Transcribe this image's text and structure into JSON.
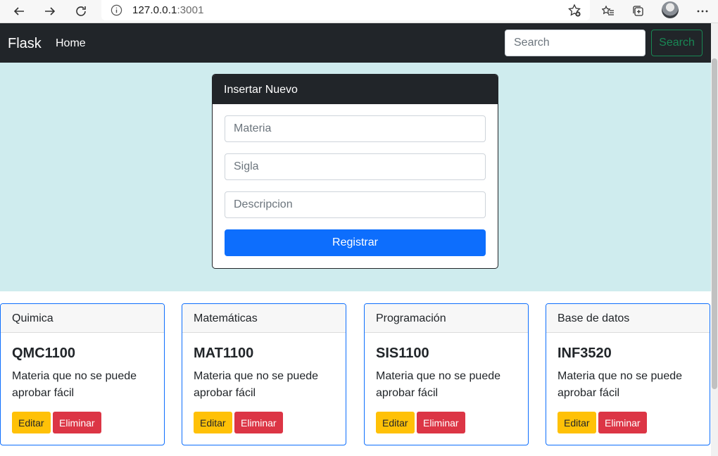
{
  "browser": {
    "url_host": "127.0.0.1",
    "url_port": ":3001",
    "icons": [
      "back-icon",
      "forward-icon",
      "refresh-icon",
      "info-icon",
      "add-favorite-icon",
      "favorites-icon",
      "collections-icon",
      "profile-avatar",
      "more-icon"
    ]
  },
  "navbar": {
    "brand": "Flask",
    "home": "Home",
    "search_placeholder": "Search",
    "search_button": "Search"
  },
  "form": {
    "title": "Insertar Nuevo",
    "materia_placeholder": "Materia",
    "sigla_placeholder": "Sigla",
    "descripcion_placeholder": "Descripcion",
    "submit": "Registrar"
  },
  "courses": [
    {
      "name": "Quimica",
      "code": "QMC1100",
      "description": "Materia que no se puede aprobar fácil"
    },
    {
      "name": "Matemáticas",
      "code": "MAT1100",
      "description": "Materia que no se puede aprobar fácil"
    },
    {
      "name": "Programación",
      "code": "SIS1100",
      "description": "Materia que no se puede aprobar fácil"
    },
    {
      "name": "Base de datos",
      "code": "INF3520",
      "description": "Materia que no se puede aprobar fácil"
    }
  ],
  "card_actions": {
    "edit": "Editar",
    "delete": "Eliminar"
  },
  "colors": {
    "navbar": "#212529",
    "hero": "#cfecee",
    "primary": "#0d6efd",
    "success": "#198754",
    "warning": "#ffc107",
    "danger": "#dc3545"
  }
}
